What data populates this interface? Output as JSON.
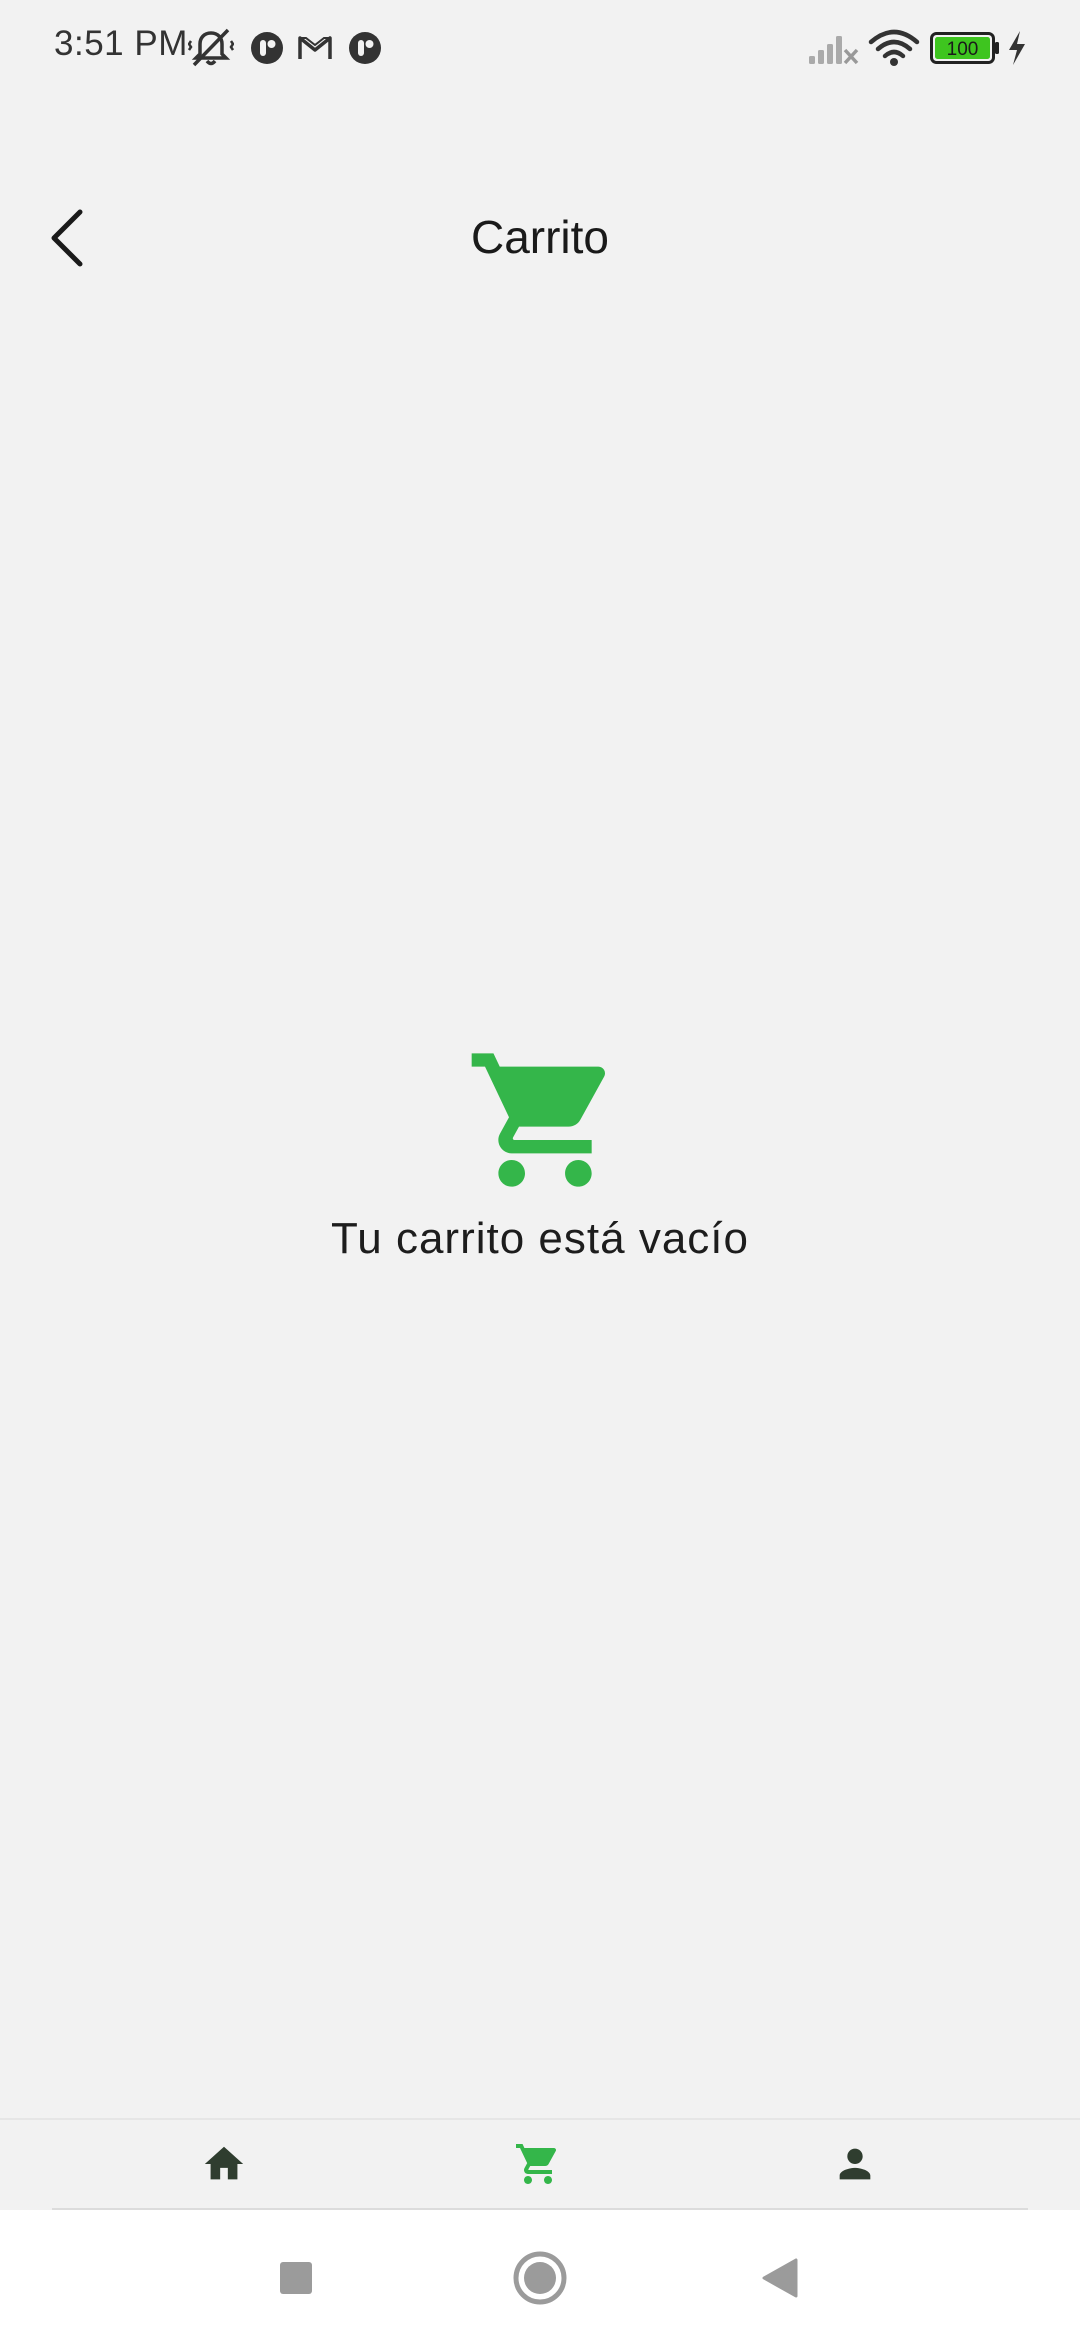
{
  "status_bar": {
    "time": "3:51 PM",
    "battery_level": "100",
    "icons": [
      "vibrate-mute-icon",
      "notification-app-icon",
      "gmail-icon",
      "notification-app-icon",
      "signal-off-icon",
      "wifi-icon",
      "battery-icon",
      "charging-icon"
    ]
  },
  "app_bar": {
    "title": "Carrito",
    "back_icon": "back-arrow-icon"
  },
  "empty_state": {
    "icon": "shopping-cart-icon",
    "message": "Tu carrito está vacío"
  },
  "bottom_nav": {
    "items": [
      {
        "name": "home",
        "icon": "home-icon",
        "active": false
      },
      {
        "name": "cart",
        "icon": "cart-icon",
        "active": true
      },
      {
        "name": "profile",
        "icon": "person-icon",
        "active": false
      }
    ]
  },
  "system_nav": {
    "buttons": [
      "recents-button",
      "home-button",
      "back-button"
    ]
  },
  "colors": {
    "background": "#f2f2f2",
    "accent_green": "#34b64a",
    "nav_icon_dark": "#2f3d2f",
    "text_dark": "#1a1a1a",
    "battery_green": "#3ec51f"
  }
}
